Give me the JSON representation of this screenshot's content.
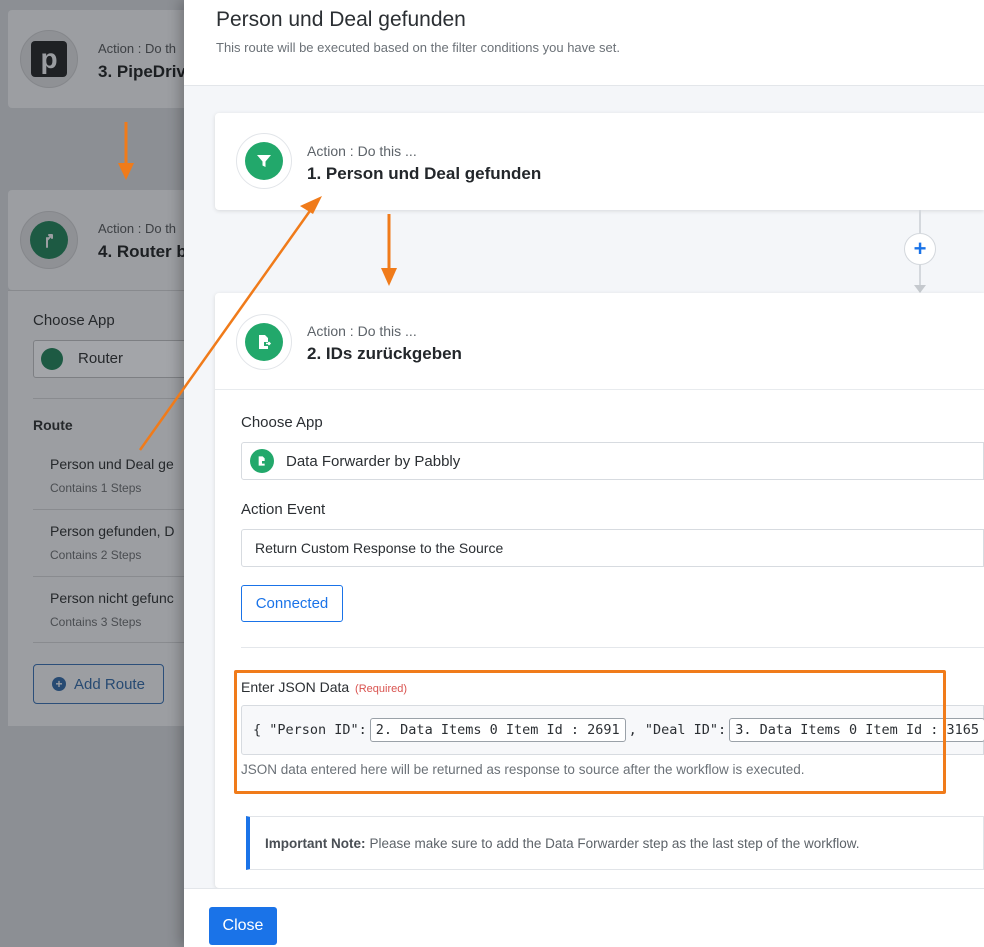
{
  "background": {
    "step3": {
      "small": "Action : Do th",
      "title": "3. PipeDriv",
      "logo_letter": "p"
    },
    "step4": {
      "small": "Action : Do th",
      "title": "4. Router b"
    },
    "choose_app_label": "Choose App",
    "app_value": "Router",
    "route_heading": "Route",
    "routes": [
      {
        "name": "Person und Deal ge",
        "steps": "Contains 1 Steps"
      },
      {
        "name": "Person gefunden, D",
        "steps": "Contains 2 Steps"
      },
      {
        "name": "Person nicht gefunc",
        "steps": "Contains 3 Steps"
      }
    ],
    "add_route_label": "Add Route"
  },
  "modal": {
    "title": "Person und Deal gefunden",
    "subtitle": "This route will be executed based on the filter conditions you have set.",
    "step1": {
      "small": "Action : Do this ...",
      "title": "1. Person und Deal gefunden"
    },
    "step2": {
      "small": "Action : Do this ...",
      "title": "2. IDs zurückgeben"
    },
    "choose_app_label": "Choose App",
    "app_value": "Data Forwarder by Pabbly",
    "action_event_label": "Action Event",
    "action_event_value": "Return Custom Response to the Source",
    "connected_label": "Connected",
    "json_label": "Enter JSON Data",
    "json_required": "(Required)",
    "json": {
      "open": "{ \"Person ID\":",
      "chip1": "2. Data Items 0 Item Id : 2691",
      "mid": ", \"Deal ID\":",
      "chip2": "3. Data Items 0 Item Id : 3165",
      "close": "}"
    },
    "json_help": "JSON data entered here will be returned as response to source after the workflow is executed.",
    "note_strong": "Important Note:",
    "note_text": "Please make sure to add the Data Forwarder step as the last step of the workflow.",
    "close_label": "Close"
  },
  "colors": {
    "accent": "#1a73e8",
    "brand_green": "#22a86b",
    "annotation": "#f07b1a"
  }
}
